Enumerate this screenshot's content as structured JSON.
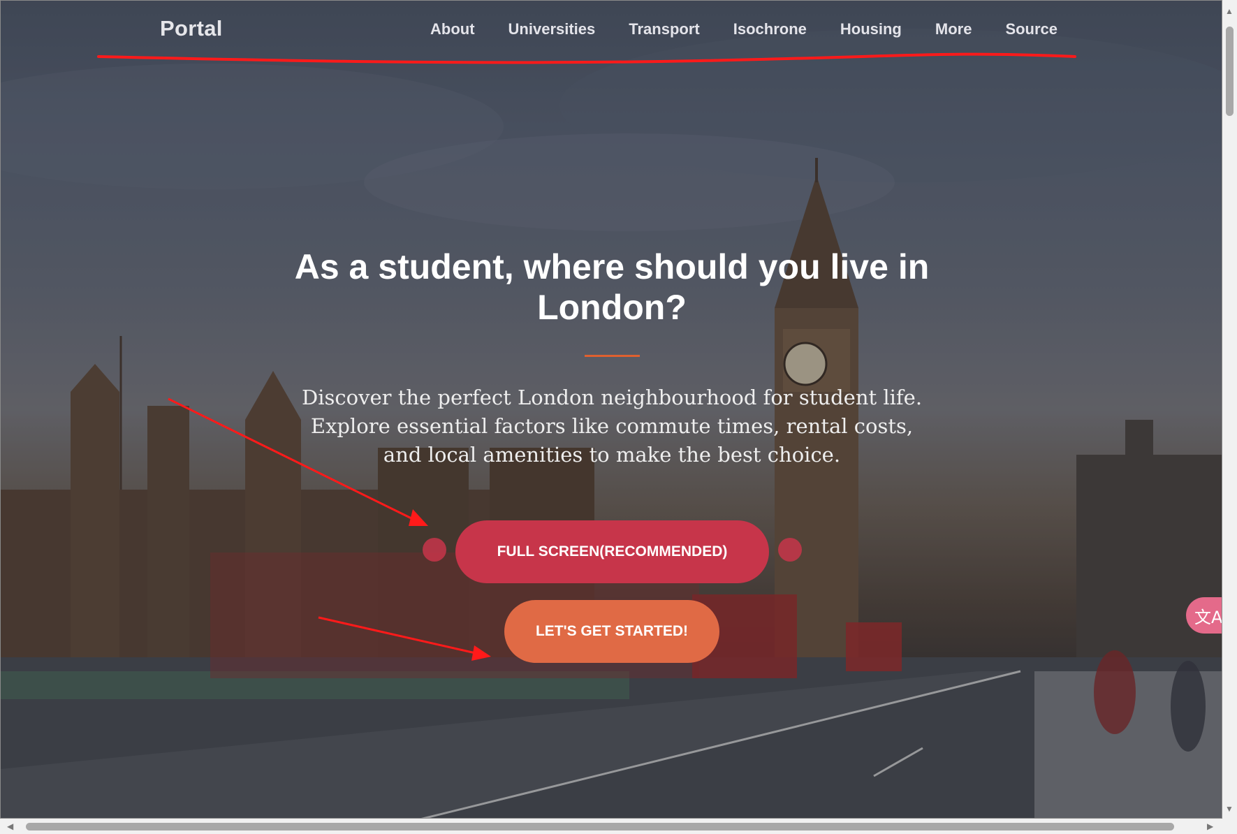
{
  "nav": {
    "brand": "Portal",
    "links": [
      "About",
      "Universities",
      "Transport",
      "Isochrone",
      "Housing",
      "More",
      "Source"
    ]
  },
  "hero": {
    "title": "As a student, where should you live in London?",
    "description": "Discover the perfect London neighbourhood for student life. Explore essential factors like commute times, rental costs, and local amenities to make the best choice.",
    "primary_button": "FULL SCREEN(RECOMMENDED)",
    "secondary_button": "LET'S GET STARTED!"
  },
  "widgets": {
    "translate_icon": "translate-icon",
    "translate_glyph": "文A"
  },
  "colors": {
    "primary_button": "#c7354a",
    "secondary_button": "#e06a45",
    "title_rule": "#e0602f",
    "annotation": "#ff1a1a"
  },
  "background_image": "Westminster Palace, Big Ben and a red double-decker bus on Westminster Bridge at dusk"
}
